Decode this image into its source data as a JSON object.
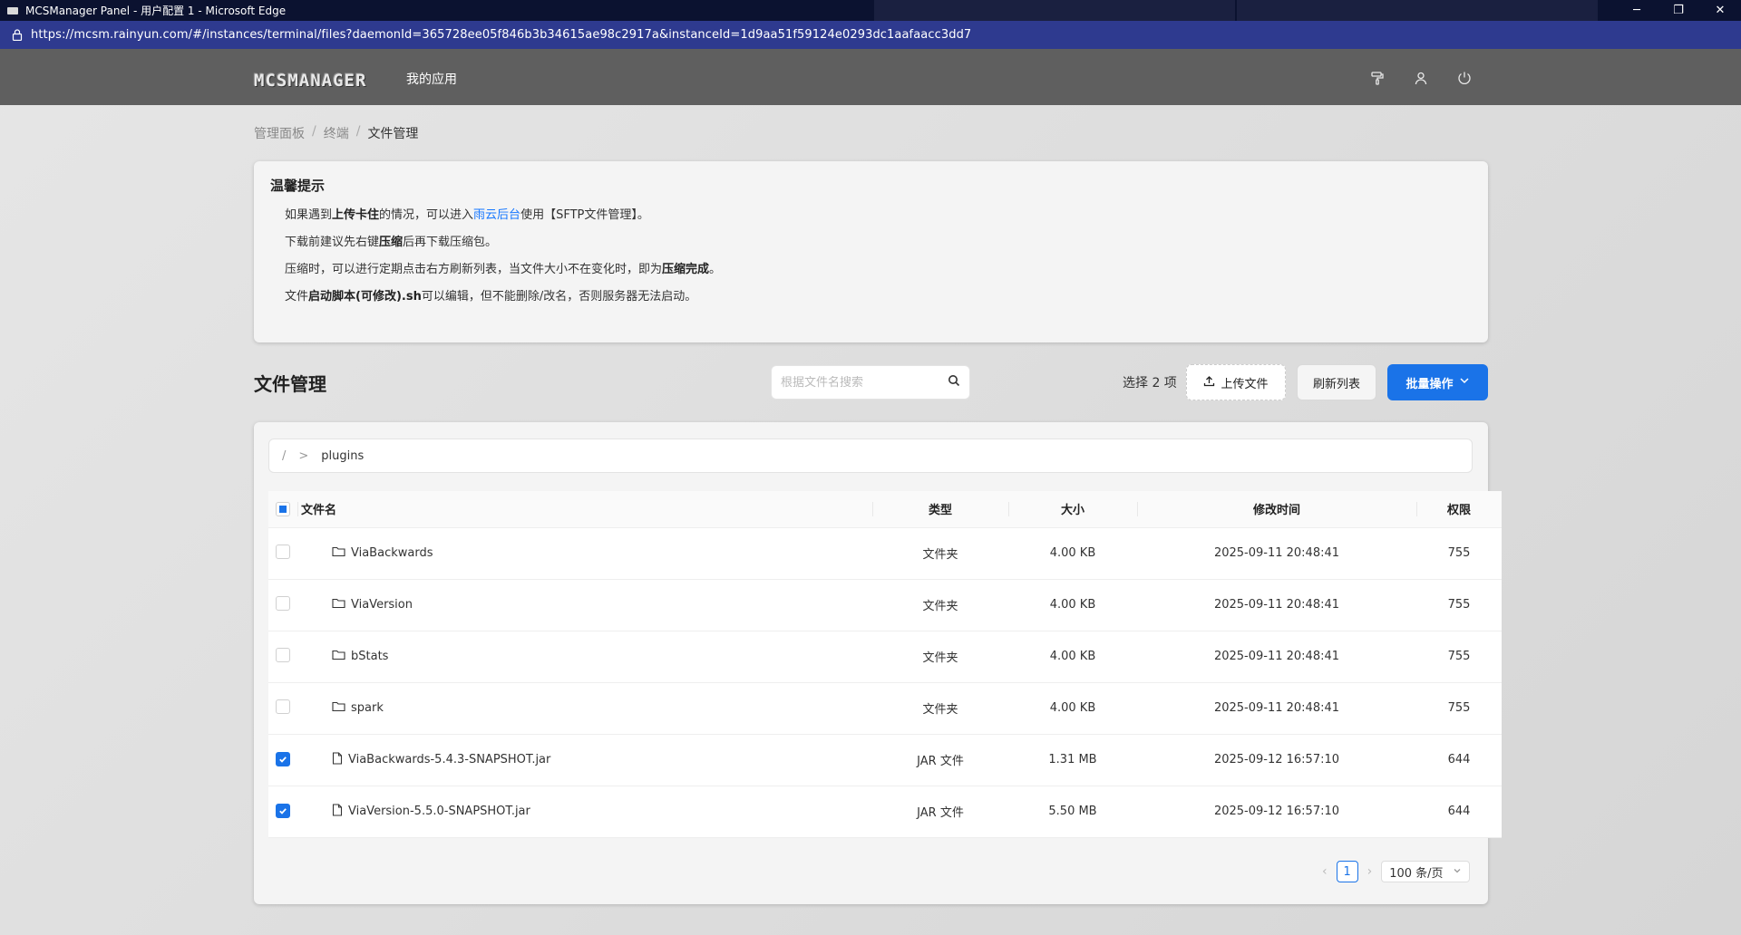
{
  "browser": {
    "title": "MCSManager Panel - 用户配置 1 - Microsoft Edge",
    "url": "https://mcsm.rainyun.com/#/instances/terminal/files?daemonId=365728ee05f846b3b34615ae98c2917a&instanceId=1d9aa51f59124e0293dc1aafaacc3dd7",
    "controls": {
      "minimize": "─",
      "restore": "❐",
      "close": "✕"
    }
  },
  "header": {
    "logo": "MCSMANAGER",
    "nav_apps": "我的应用",
    "icons": [
      "paint-roller-icon",
      "user-icon",
      "logout-icon"
    ]
  },
  "breadcrumb": [
    "管理面板",
    "终端",
    "文件管理"
  ],
  "notice": {
    "title": "温馨提示",
    "line1": {
      "a": "如果遇到",
      "b": "上传卡住",
      "c": "的情况，可以进入",
      "link": "雨云后台",
      "d": "使用【SFTP文件管理】。"
    },
    "line2": {
      "a": "下载前建议先右键",
      "b": "压缩",
      "c": "后再下载压缩包。"
    },
    "line3": {
      "a": "压缩时，可以进行定期点击右方刷新列表，当文件大小不在变化时，即为",
      "b": "压缩完成",
      "c": "。"
    },
    "line4": {
      "a": "文件",
      "b": "启动脚本(可修改).sh",
      "c": "可以编辑，但不能删除/改名，否则服务器无法启动。"
    }
  },
  "toolbar": {
    "title": "文件管理",
    "search_placeholder": "根据文件名搜索",
    "selected": "选择 2 项",
    "upload": "上传文件",
    "refresh": "刷新列表",
    "batch": "批量操作"
  },
  "path": {
    "root": "/",
    "sep": ">",
    "current": "plugins"
  },
  "table": {
    "headers": {
      "name": "文件名",
      "type": "类型",
      "size": "大小",
      "mtime": "修改时间",
      "perm": "权限"
    },
    "rows": [
      {
        "name": "ViaBackwards",
        "type": "文件夹",
        "size": "4.00 KB",
        "mtime": "2025-09-11 20:48:41",
        "perm": "755"
      },
      {
        "name": "ViaVersion",
        "type": "文件夹",
        "size": "4.00 KB",
        "mtime": "2025-09-11 20:48:41",
        "perm": "755"
      },
      {
        "name": "bStats",
        "type": "文件夹",
        "size": "4.00 KB",
        "mtime": "2025-09-11 20:48:41",
        "perm": "755"
      },
      {
        "name": "spark",
        "type": "文件夹",
        "size": "4.00 KB",
        "mtime": "2025-09-11 20:48:41",
        "perm": "755"
      },
      {
        "name": "ViaBackwards-5.4.3-SNAPSHOT.jar",
        "type": "JAR 文件",
        "size": "1.31 MB",
        "mtime": "2025-09-12 16:57:10",
        "perm": "644"
      },
      {
        "name": "ViaVersion-5.5.0-SNAPSHOT.jar",
        "type": "JAR 文件",
        "size": "5.50 MB",
        "mtime": "2025-09-12 16:57:10",
        "perm": "644"
      }
    ],
    "checked": [
      false,
      false,
      false,
      false,
      true,
      true
    ]
  },
  "pagination": {
    "page": "1",
    "page_size": "100 条/页"
  }
}
